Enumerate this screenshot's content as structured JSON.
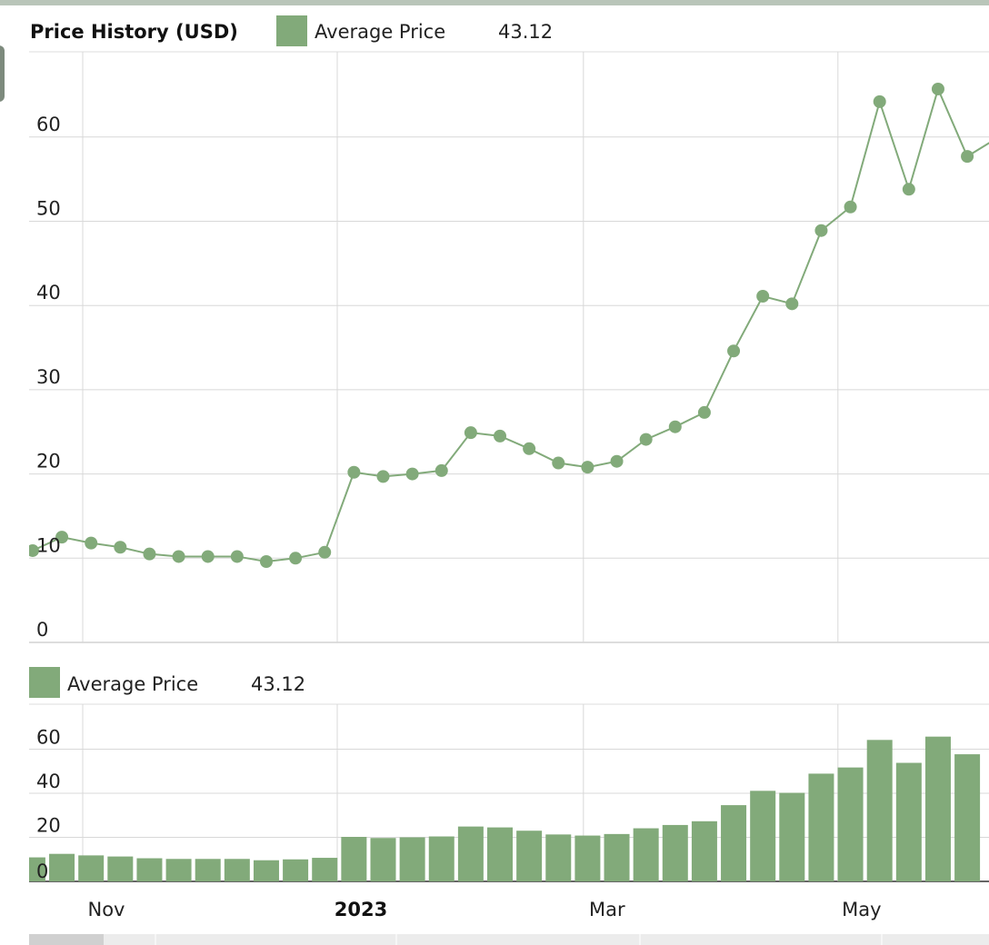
{
  "chart_data": [
    {
      "type": "line",
      "title": "Price History (USD)",
      "legend": {
        "label": "Average Price",
        "value": "43.12",
        "placement": "top"
      },
      "color": "#82aa7a",
      "ylim": [
        0,
        70
      ],
      "yticks": [
        "0",
        "10",
        "20",
        "30",
        "40",
        "50",
        "60"
      ],
      "grid": true,
      "x": [
        "2022-10-20",
        "2022-10-27",
        "2022-11-03",
        "2022-11-10",
        "2022-11-17",
        "2022-11-24",
        "2022-12-01",
        "2022-12-08",
        "2022-12-15",
        "2022-12-22",
        "2022-12-29",
        "2023-01-05",
        "2023-01-12",
        "2023-01-19",
        "2023-01-26",
        "2023-02-02",
        "2023-02-09",
        "2023-02-16",
        "2023-02-23",
        "2023-03-02",
        "2023-03-09",
        "2023-03-16",
        "2023-03-23",
        "2023-03-30",
        "2023-04-06",
        "2023-04-13",
        "2023-04-20",
        "2023-04-27",
        "2023-05-04",
        "2023-05-11",
        "2023-05-18",
        "2023-05-25",
        "2023-06-01"
      ],
      "values": [
        10.9,
        12.5,
        11.8,
        11.3,
        10.5,
        10.2,
        10.2,
        10.2,
        9.6,
        10.0,
        10.7,
        20.2,
        19.7,
        20.0,
        20.4,
        24.9,
        24.5,
        23.0,
        21.3,
        20.8,
        21.5,
        24.1,
        25.6,
        27.3,
        34.6,
        41.1,
        40.2,
        48.9,
        51.7,
        64.2,
        53.8,
        65.7,
        57.7
      ]
    },
    {
      "type": "bar",
      "legend": {
        "label": "Average Price",
        "value": "43.12",
        "placement": "top-left"
      },
      "color": "#82aa7a",
      "ylim": [
        0,
        70
      ],
      "yticks": [
        "0",
        "20",
        "40",
        "60"
      ],
      "grid": true,
      "values_from": "same as line series"
    }
  ],
  "xaxis": {
    "ticks": [
      {
        "label": "Nov",
        "date": "2022-11-01",
        "bold": false
      },
      {
        "label": "2023",
        "date": "2023-01-01",
        "bold": true
      },
      {
        "label": "Mar",
        "date": "2023-03-01",
        "bold": false
      },
      {
        "label": "May",
        "date": "2023-05-01",
        "bold": false
      }
    ]
  }
}
